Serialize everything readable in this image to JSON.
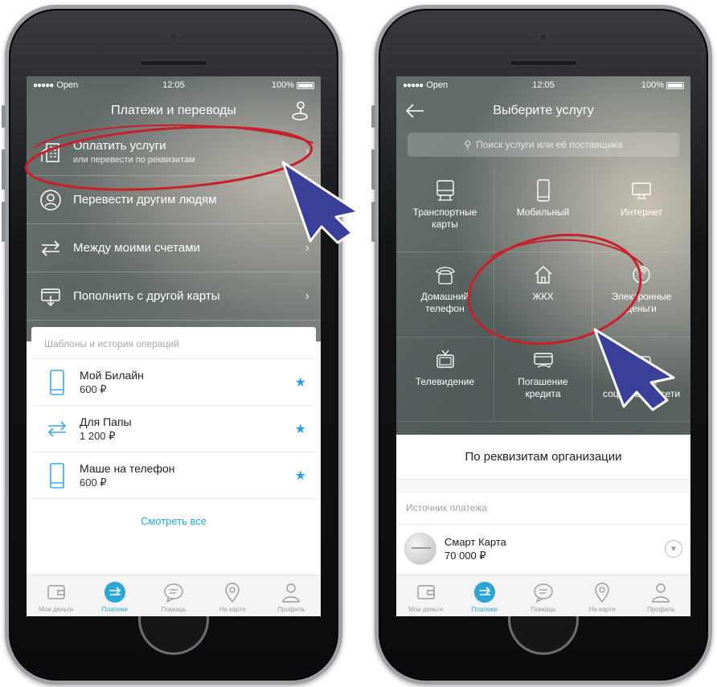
{
  "left_phone": {
    "status": {
      "carrier": "Open",
      "time": "12:05",
      "battery": "100%"
    },
    "header": {
      "title": "Платежи и переводы"
    },
    "menu": [
      {
        "title": "Оплатить услуги",
        "subtitle": "или перевести по реквизитам",
        "icon": "building-icon"
      },
      {
        "title": "Перевести другим людям",
        "subtitle": "",
        "icon": "person-icon"
      },
      {
        "title": "Между моими счетами",
        "subtitle": "",
        "icon": "transfer-arrows-icon"
      },
      {
        "title": "Пополнить с другой карты",
        "subtitle": "",
        "icon": "card-topup-icon"
      }
    ],
    "templates": {
      "title": "Шаблоны и история операций",
      "items": [
        {
          "name": "Мой Билайн",
          "amount": "600 ₽",
          "icon": "phone-icon"
        },
        {
          "name": "Для Папы",
          "amount": "1 200 ₽",
          "icon": "transfer-arrows-icon"
        },
        {
          "name": "Маше на телефон",
          "amount": "600 ₽",
          "icon": "phone-icon"
        }
      ],
      "see_all": "Смотреть все"
    },
    "tabs": [
      {
        "label": "Мои деньги",
        "icon": "wallet-icon"
      },
      {
        "label": "Платежи",
        "icon": "payments-arrow-icon",
        "active": true
      },
      {
        "label": "Помощь",
        "icon": "chat-bubble-icon"
      },
      {
        "label": "На карте",
        "icon": "map-pin-icon"
      },
      {
        "label": "Профиль",
        "icon": "profile-icon"
      }
    ]
  },
  "right_phone": {
    "status": {
      "carrier": "Open",
      "time": "12:05",
      "battery": "100%"
    },
    "header": {
      "title": "Выберите услугу"
    },
    "search": {
      "placeholder": "Поиск услуги или её поставщика"
    },
    "services": [
      {
        "label": "Транспортные карты",
        "icon": "transport-card-icon"
      },
      {
        "label": "Мобильный",
        "icon": "mobile-phone-icon"
      },
      {
        "label": "Интернет",
        "icon": "monitor-icon"
      },
      {
        "label": "Домашний телефон",
        "icon": "landline-phone-icon"
      },
      {
        "label": "ЖКХ",
        "icon": "house-icon"
      },
      {
        "label": "Электронные деньги",
        "icon": "e-money-icon"
      },
      {
        "label": "Телевидение",
        "icon": "tv-icon"
      },
      {
        "label": "Погашение кредита",
        "icon": "credit-payment-icon"
      },
      {
        "label": "Игры и социальные сети",
        "icon": "gamepad-icon"
      }
    ],
    "by_requisites": "По реквизитам организации",
    "payment_source": {
      "title": "Источник платежа",
      "card_name": "Смарт Карта",
      "card_amount": "70 000 ₽"
    },
    "tabs": [
      {
        "label": "Мои деньги",
        "icon": "wallet-icon"
      },
      {
        "label": "Платежи",
        "icon": "payments-arrow-icon",
        "active": true
      },
      {
        "label": "Помощь",
        "icon": "chat-bubble-icon"
      },
      {
        "label": "На карте",
        "icon": "map-pin-icon"
      },
      {
        "label": "Профиль",
        "icon": "profile-icon"
      }
    ]
  },
  "colors": {
    "accent": "#2aa5d5",
    "annotation": "#c8202b",
    "pointer": "#3a3f9a"
  }
}
